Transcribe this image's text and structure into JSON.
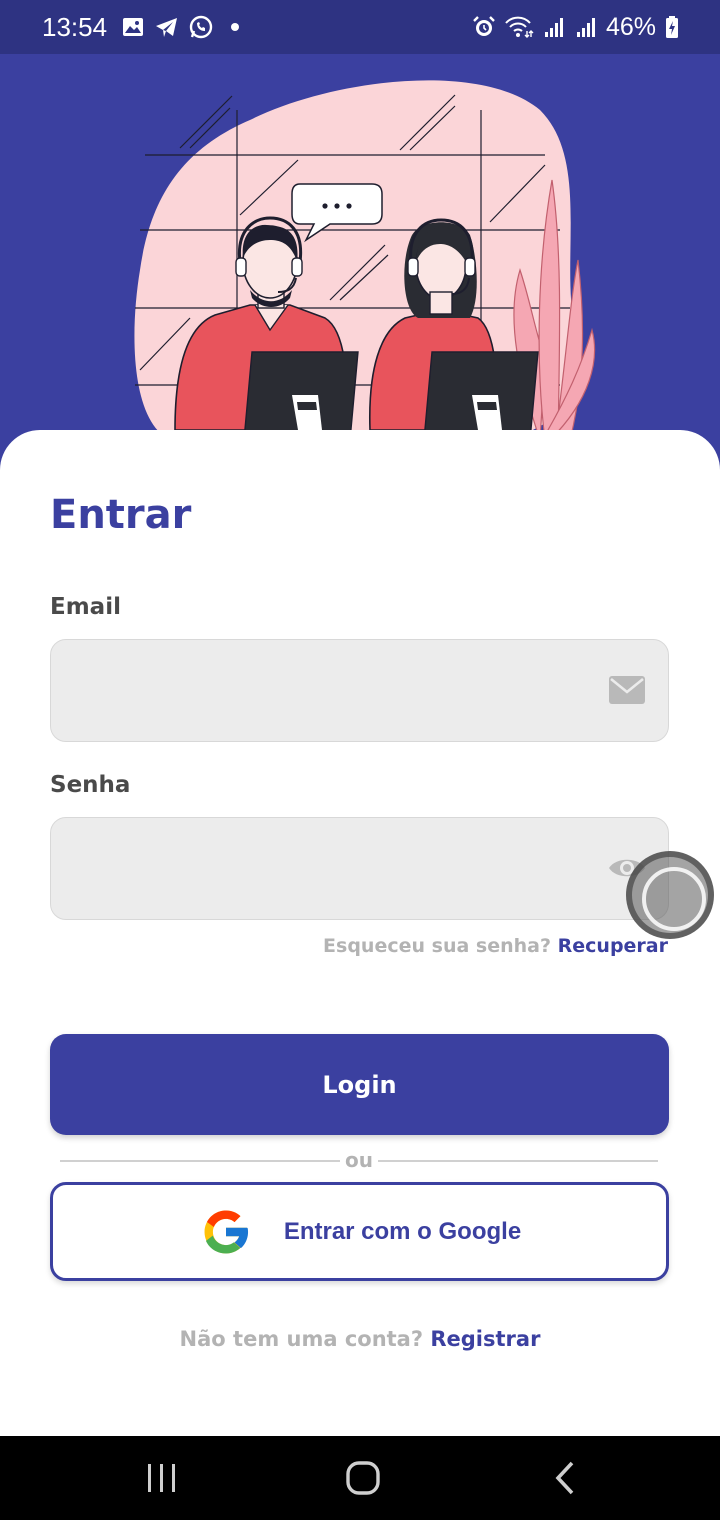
{
  "status_bar": {
    "time": "13:54",
    "battery": "46%",
    "left_icons": [
      "image-icon",
      "telegram-icon",
      "whatsapp-icon",
      "dot-icon"
    ],
    "right_icons": [
      "alarm-icon",
      "wifi-icon",
      "signal-icon",
      "signal-icon",
      "battery-charging-icon"
    ]
  },
  "illustration": {
    "bubble_text": "..."
  },
  "form": {
    "title": "Entrar",
    "email_label": "Email",
    "email_value": "",
    "email_icon": "envelope-icon",
    "password_label": "Senha",
    "password_value": "",
    "password_icon": "eye-icon",
    "forgot_text": "Esqueceu sua senha?",
    "forgot_link": "Recuperar",
    "login_button": "Login",
    "divider_text": "ou",
    "google_button": "Entrar com o Google",
    "register_text": "Não tem uma conta?",
    "register_link": "Registrar"
  },
  "nav_bar": {
    "buttons": [
      "recent-apps-icon",
      "home-icon",
      "back-icon"
    ]
  },
  "colors": {
    "primary": "#3b40a0",
    "status_bar": "#2e3382",
    "muted_text": "#b3b3b3",
    "input_bg": "#ececec",
    "blob": "#fbd5d8",
    "shirt": "#e8545c"
  }
}
